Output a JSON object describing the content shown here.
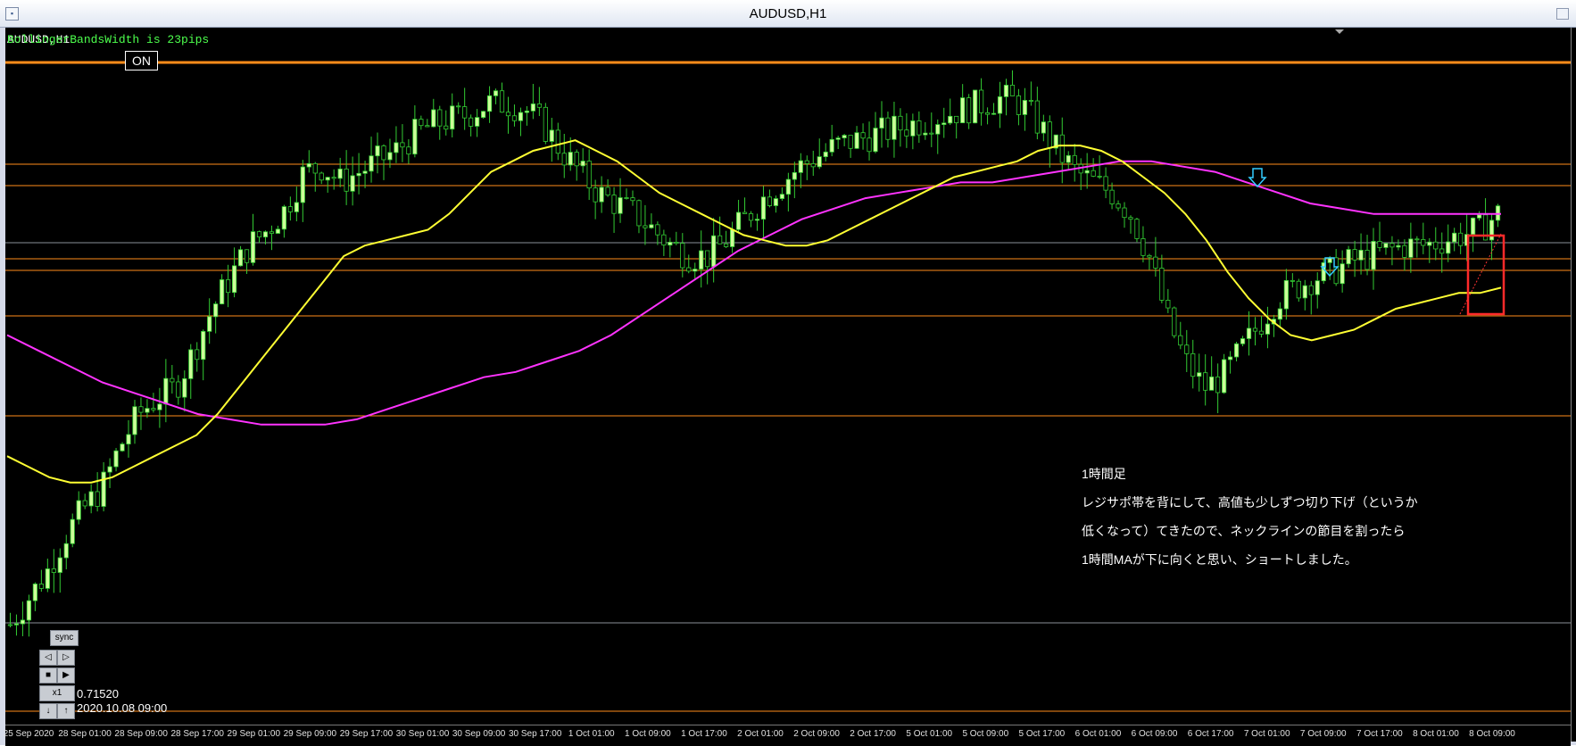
{
  "window": {
    "title": "AUDUSD,H1"
  },
  "overlay": {
    "indicator_text": "BollingerBandsWidth is 23pips",
    "symbol_label": "AUDUSD,H1"
  },
  "on_button_label": "ON",
  "annotation": {
    "lines": [
      "1時間足",
      "レジサポ帯を背にして、高値も少しずつ切り下げ（というか",
      "低くなって）てきたので、ネックラインの節目を割ったら",
      "1時間MAが下に向くと思い、ショートしました。"
    ]
  },
  "tester": {
    "sync_label": "sync",
    "speed_label": "x1",
    "price": "0.71520",
    "datetime": "2020.10.08 09:00",
    "down_arrow": "↓",
    "up_arrow": "↑",
    "prev": "◁",
    "next": "▷",
    "stop": "■",
    "play": "▶"
  },
  "colors": {
    "background": "#000000",
    "bull_candle": "#ccff99",
    "candle_wick": "#33cc33",
    "bear_candle": "#000000",
    "ma_short": "#ffff33",
    "ma_long": "#ff33ff",
    "level_lines": "#ff8c1a",
    "gray_line": "#8a8f99",
    "marker_box": "#ff2a2a",
    "arrow": "#33ccff"
  },
  "chart_data": {
    "type": "candlestick",
    "symbol": "AUDUSD",
    "timeframe": "H1",
    "x_tick_labels": [
      "25 Sep 2020",
      "28 Sep 01:00",
      "28 Sep 09:00",
      "28 Sep 17:00",
      "29 Sep 01:00",
      "29 Sep 09:00",
      "29 Sep 17:00",
      "30 Sep 01:00",
      "30 Sep 09:00",
      "30 Sep 17:00",
      "1 Oct 01:00",
      "1 Oct 09:00",
      "1 Oct 17:00",
      "2 Oct 01:00",
      "2 Oct 09:00",
      "2 Oct 17:00",
      "5 Oct 01:00",
      "5 Oct 09:00",
      "5 Oct 17:00",
      "6 Oct 01:00",
      "6 Oct 09:00",
      "6 Oct 17:00",
      "7 Oct 01:00",
      "7 Oct 09:00",
      "7 Oct 17:00",
      "8 Oct 01:00",
      "8 Oct 09:00"
    ],
    "close_path": [
      0.0,
      0.05,
      0.1,
      0.17,
      0.22,
      0.26,
      0.34,
      0.4,
      0.43,
      0.45,
      0.52,
      0.6,
      0.66,
      0.72,
      0.75,
      0.79,
      0.86,
      0.87,
      0.84,
      0.86,
      0.88,
      0.9,
      0.93,
      0.95,
      0.96,
      0.97,
      0.99,
      0.99,
      0.98,
      0.95,
      0.9,
      0.86,
      0.82,
      0.8,
      0.78,
      0.75,
      0.72,
      0.7,
      0.7,
      0.73,
      0.77,
      0.81,
      0.84,
      0.87,
      0.89,
      0.91,
      0.92,
      0.93,
      0.94,
      0.95,
      0.96,
      0.97,
      0.98,
      0.99,
      1.0,
      0.99,
      0.95,
      0.9,
      0.86,
      0.84,
      0.82,
      0.78,
      0.7,
      0.58,
      0.5,
      0.45,
      0.47,
      0.52,
      0.57,
      0.62,
      0.64,
      0.66,
      0.67,
      0.69,
      0.7,
      0.71,
      0.72,
      0.72,
      0.73,
      0.74,
      0.75,
      0.78
    ],
    "ma_short_path": [
      0.32,
      0.3,
      0.28,
      0.27,
      0.27,
      0.28,
      0.3,
      0.32,
      0.34,
      0.36,
      0.4,
      0.45,
      0.5,
      0.55,
      0.6,
      0.65,
      0.7,
      0.72,
      0.73,
      0.74,
      0.75,
      0.78,
      0.82,
      0.86,
      0.88,
      0.9,
      0.91,
      0.92,
      0.9,
      0.88,
      0.85,
      0.82,
      0.8,
      0.78,
      0.76,
      0.74,
      0.73,
      0.72,
      0.72,
      0.73,
      0.75,
      0.77,
      0.79,
      0.81,
      0.83,
      0.85,
      0.86,
      0.87,
      0.88,
      0.9,
      0.91,
      0.91,
      0.9,
      0.88,
      0.85,
      0.82,
      0.78,
      0.73,
      0.67,
      0.62,
      0.58,
      0.55,
      0.54,
      0.55,
      0.56,
      0.58,
      0.6,
      0.61,
      0.62,
      0.63,
      0.63,
      0.64
    ],
    "ma_long_path": [
      0.55,
      0.52,
      0.49,
      0.46,
      0.44,
      0.42,
      0.4,
      0.39,
      0.38,
      0.38,
      0.38,
      0.39,
      0.41,
      0.43,
      0.45,
      0.47,
      0.48,
      0.5,
      0.52,
      0.55,
      0.59,
      0.63,
      0.67,
      0.71,
      0.74,
      0.77,
      0.79,
      0.81,
      0.82,
      0.83,
      0.84,
      0.84,
      0.85,
      0.86,
      0.87,
      0.88,
      0.88,
      0.87,
      0.86,
      0.84,
      0.82,
      0.8,
      0.79,
      0.78,
      0.78,
      0.78,
      0.78,
      0.78
    ]
  }
}
